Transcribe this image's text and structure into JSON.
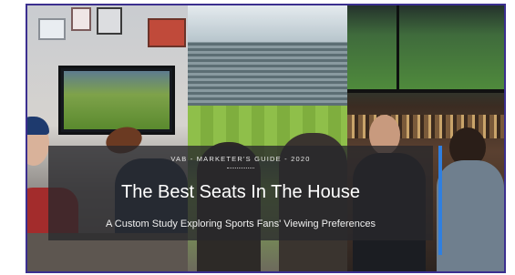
{
  "banner": {
    "kicker": "VAB - MARKETER'S GUIDE - 2020",
    "title": "The Best Seats In The House",
    "subtitle": "A Custom Study Exploring Sports Fans' Viewing Preferences"
  },
  "colors": {
    "frame_border": "#3b2f8f",
    "accent_blue": "#2f7fe0",
    "overlay": "#28282c"
  },
  "images": [
    "living-room-fans-photo",
    "stadium-crowd-photo",
    "sports-bar-fans-photo"
  ]
}
